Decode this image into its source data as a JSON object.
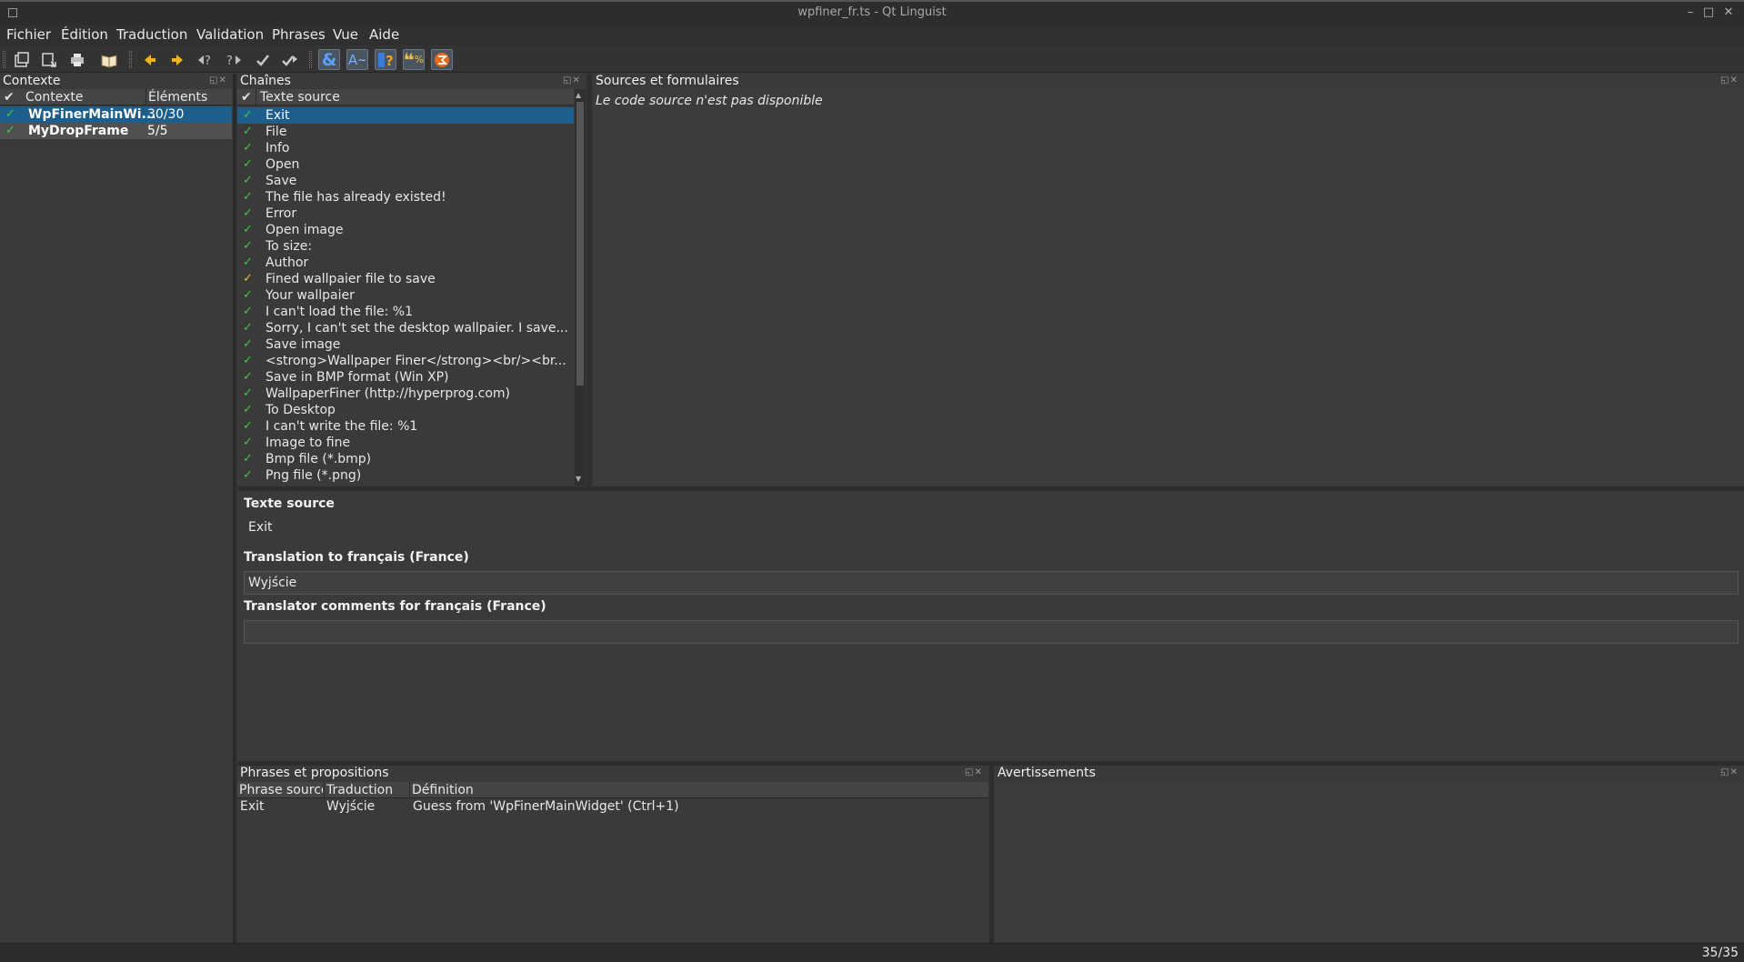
{
  "window": {
    "title": "wpfiner_fr.ts - Qt Linguist"
  },
  "menu": [
    "Fichier",
    "Édition",
    "Traduction",
    "Validation",
    "Phrases",
    "Vue",
    "Aide"
  ],
  "contexts": {
    "title": "Contexte",
    "col_context": "Contexte",
    "col_items": "Éléments",
    "rows": [
      {
        "name": "WpFinerMainWi...",
        "count": "30/30"
      },
      {
        "name": "MyDropFrame",
        "count": "5/5"
      }
    ]
  },
  "strings": {
    "title": "Chaînes",
    "col_source": "Texte source",
    "rows": [
      "Exit",
      "File",
      "Info",
      "Open",
      "Save",
      "The file has already existed!",
      "Error",
      "Open image",
      "To size:",
      "Author",
      "Fined wallpaier file to save",
      "Your wallpaier",
      "I can't load the file: %1",
      "Sorry, I can't set the desktop wallpaier. I save...",
      "Save image",
      "<strong>Wallpaper Finer</strong><br/><br...",
      "Save in BMP format (Win XP)",
      "WallpaperFiner (http://hyperprog.com)",
      "To Desktop",
      "I can't write the file: %1",
      "Image to fine",
      "Bmp file (*.bmp)",
      "Png file (*.png)"
    ],
    "yellow_row": 10
  },
  "sources": {
    "title": "Sources et formulaires",
    "message": "Le code source n'est pas disponible"
  },
  "editor": {
    "source_label": "Texte source",
    "source_text": "Exit",
    "translation_label": "Translation to français (France)",
    "translation_value": "Wyjście",
    "comments_label": "Translator comments for français (France)",
    "comments_value": ""
  },
  "phrases": {
    "title": "Phrases et propositions",
    "col_source": "Phrase source",
    "col_translation": "Traduction",
    "col_definition": "Définition",
    "rows": [
      {
        "source": "Exit",
        "translation": "Wyjście",
        "definition": "Guess from 'WpFinerMainWidget' (Ctrl+1)"
      }
    ]
  },
  "warnings": {
    "title": "Avertissements"
  },
  "status": {
    "progress": "35/35"
  },
  "colors": {
    "selection": "#1c5e8c",
    "check_green": "#3ecb3e",
    "check_yellow": "#e0c530",
    "background": "#3a3a3a"
  }
}
